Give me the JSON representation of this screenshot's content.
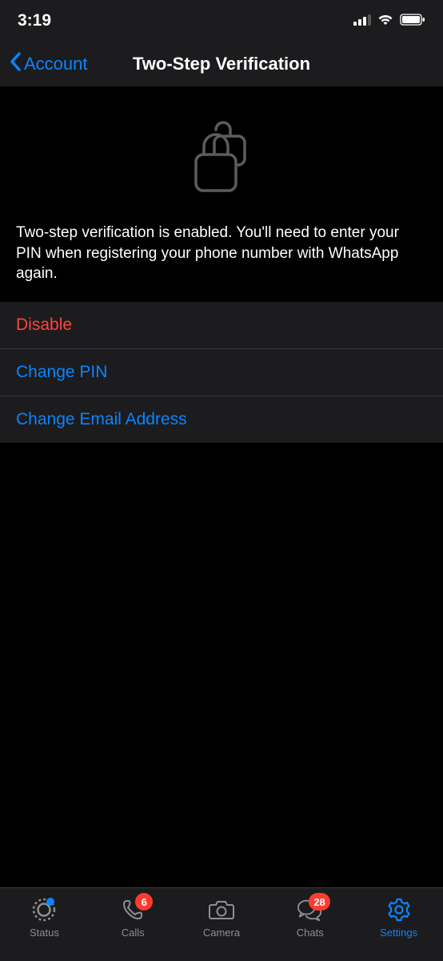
{
  "status_bar": {
    "time": "3:19"
  },
  "nav": {
    "back_label": "Account",
    "title": "Two-Step Verification"
  },
  "description": "Two-step verification is enabled. You'll need to enter your PIN when registering your phone number with WhatsApp again.",
  "actions": {
    "disable": "Disable",
    "change_pin": "Change PIN",
    "change_email": "Change Email Address"
  },
  "tabs": {
    "status": {
      "label": "Status"
    },
    "calls": {
      "label": "Calls",
      "badge": "6"
    },
    "camera": {
      "label": "Camera"
    },
    "chats": {
      "label": "Chats",
      "badge": "28"
    },
    "settings": {
      "label": "Settings"
    }
  }
}
